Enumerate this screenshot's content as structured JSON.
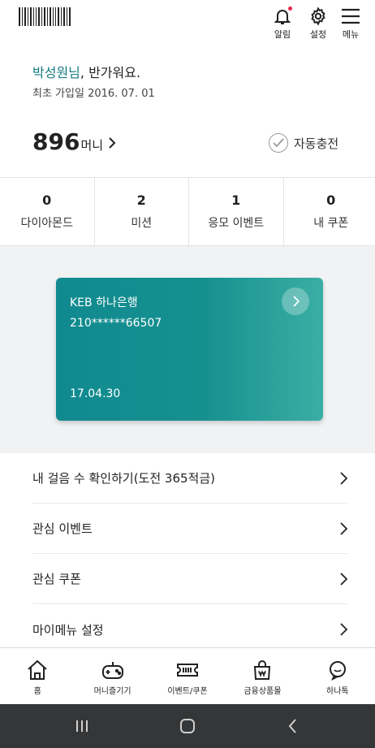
{
  "header": {
    "icons": [
      {
        "name": "bell-icon",
        "label": "알림",
        "has_badge": true
      },
      {
        "name": "gear-icon",
        "label": "설정"
      },
      {
        "name": "hamburger-icon",
        "label": "메뉴"
      }
    ]
  },
  "profile": {
    "name": "박성원님",
    "greeting": ", 반가워요.",
    "join_date": "최초 가입일 2016. 07. 01"
  },
  "balance": {
    "amount": "896",
    "unit": "머니",
    "auto_charge_label": "자동충전"
  },
  "stats": [
    {
      "value": "0",
      "label": "다이아몬드"
    },
    {
      "value": "2",
      "label": "미션"
    },
    {
      "value": "1",
      "label": "응모 이벤트"
    },
    {
      "value": "0",
      "label": "내 쿠폰"
    }
  ],
  "card": {
    "bank": "KEB 하나은행",
    "account": "210******66507",
    "date": "17.04.30"
  },
  "menu": [
    {
      "label": "내 걸음 수 확인하기(도전 365적금)"
    },
    {
      "label": "관심 이벤트"
    },
    {
      "label": "관심 쿠폰"
    },
    {
      "label": "마이메뉴 설정"
    }
  ],
  "tabbar": [
    {
      "icon": "home-icon",
      "label": "홈"
    },
    {
      "icon": "gamepad-icon",
      "label": "머니즐기기"
    },
    {
      "icon": "ticket-icon",
      "label": "이벤트/쿠폰"
    },
    {
      "icon": "shopping-bag-icon",
      "label": "금융상품몰"
    },
    {
      "icon": "chat-icon",
      "label": "하나톡"
    }
  ],
  "colors": {
    "accent": "#137a80",
    "card_start": "#108a8f",
    "card_end": "#3aaea4",
    "badge": "#e8254b"
  }
}
